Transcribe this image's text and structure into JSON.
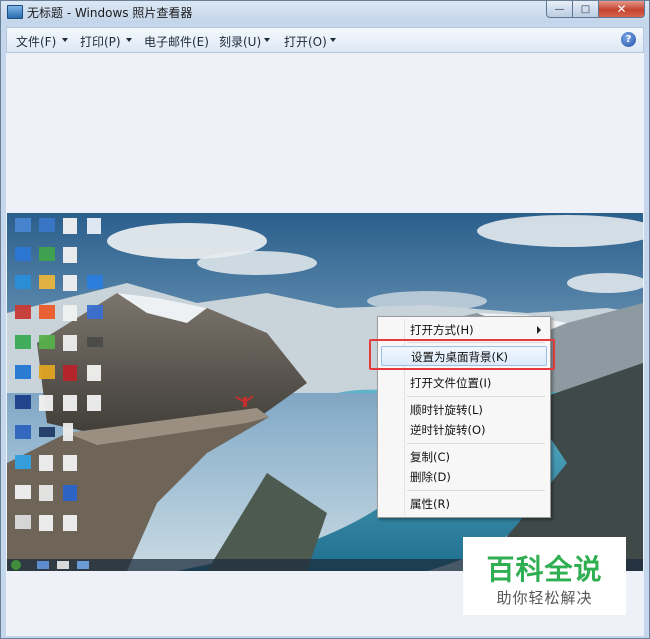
{
  "window": {
    "title": "无标题 - Windows 照片查看器",
    "minimize_glyph": "—",
    "maximize_glyph": "□",
    "close_glyph": "✕"
  },
  "menubar": {
    "items": [
      {
        "label": "文件(F)",
        "has_dropdown": true
      },
      {
        "label": "打印(P)",
        "has_dropdown": true
      },
      {
        "label": "电子邮件(E)",
        "has_dropdown": false
      },
      {
        "label": "刻录(U)",
        "has_dropdown": true
      },
      {
        "label": "打开(O)",
        "has_dropdown": true
      }
    ],
    "help_glyph": "?"
  },
  "context_menu": {
    "items": [
      {
        "label": "打开方式(H)",
        "has_submenu": true
      },
      {
        "label": "设置为桌面背景(K)",
        "highlighted": true
      },
      {
        "label": "打开文件位置(I)"
      },
      {
        "label": "顺时针旋转(L)"
      },
      {
        "label": "逆时针旋转(O)"
      },
      {
        "label": "复制(C)"
      },
      {
        "label": "删除(D)"
      },
      {
        "label": "属性(R)"
      }
    ]
  },
  "watermark": {
    "title": "百科全说",
    "subtitle": "助你轻松解决"
  },
  "colors": {
    "highlight_box": "#e53a3a",
    "watermark_green": "#2fae52"
  }
}
